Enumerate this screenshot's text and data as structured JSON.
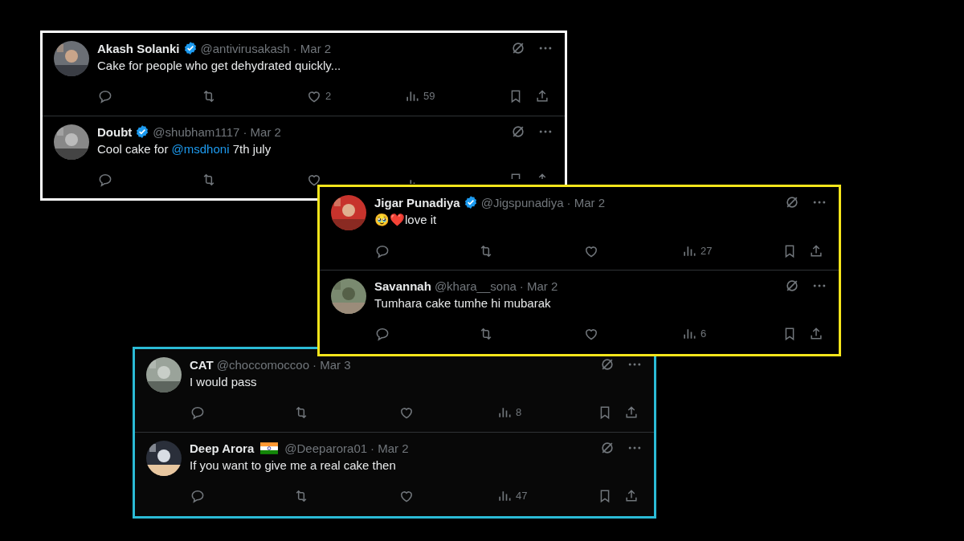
{
  "panels": [
    {
      "color": "#ffffff",
      "tweets": [
        {
          "name": "Akash Solanki",
          "verified": true,
          "flag": false,
          "handle": "@antivirusakash",
          "date": "· Mar 2",
          "text": [
            {
              "t": "Cake for people who get dehydrated quickly..."
            }
          ],
          "likes": "2",
          "views": "59"
        },
        {
          "name": "Doubt",
          "verified": true,
          "flag": false,
          "handle": "@shubham1117",
          "date": "· Mar 2",
          "text": [
            {
              "t": "Cool cake for "
            },
            {
              "t": "@msdhoni",
              "kind": "mention"
            },
            {
              "t": " 7th july"
            }
          ]
        }
      ]
    },
    {
      "color": "#f5e51b",
      "tweets": [
        {
          "name": "Jigar Punadiya",
          "verified": true,
          "flag": false,
          "handle": "@Jigspunadiya",
          "date": "· Mar 2",
          "text": [
            {
              "t": "🥹❤️love it"
            }
          ],
          "views": "27"
        },
        {
          "name": "Savannah",
          "verified": false,
          "flag": false,
          "handle": "@khara__sona",
          "date": "· Mar 2",
          "text": [
            {
              "t": "Tumhara cake tumhe hi mubarak"
            }
          ],
          "views": "6"
        }
      ]
    },
    {
      "color": "#2bbbd6",
      "tweets": [
        {
          "name": "CAT",
          "verified": false,
          "flag": false,
          "handle": "@choccomoccoo",
          "date": "· Mar 3",
          "text": [
            {
              "t": "I would pass"
            }
          ],
          "views": "8"
        },
        {
          "name": "Deep Arora",
          "verified": false,
          "flag": true,
          "handle": "@Deeparora01",
          "date": "· Mar 2",
          "text": [
            {
              "t": "If you want to give me a real cake then"
            }
          ],
          "views": "47"
        }
      ]
    }
  ]
}
